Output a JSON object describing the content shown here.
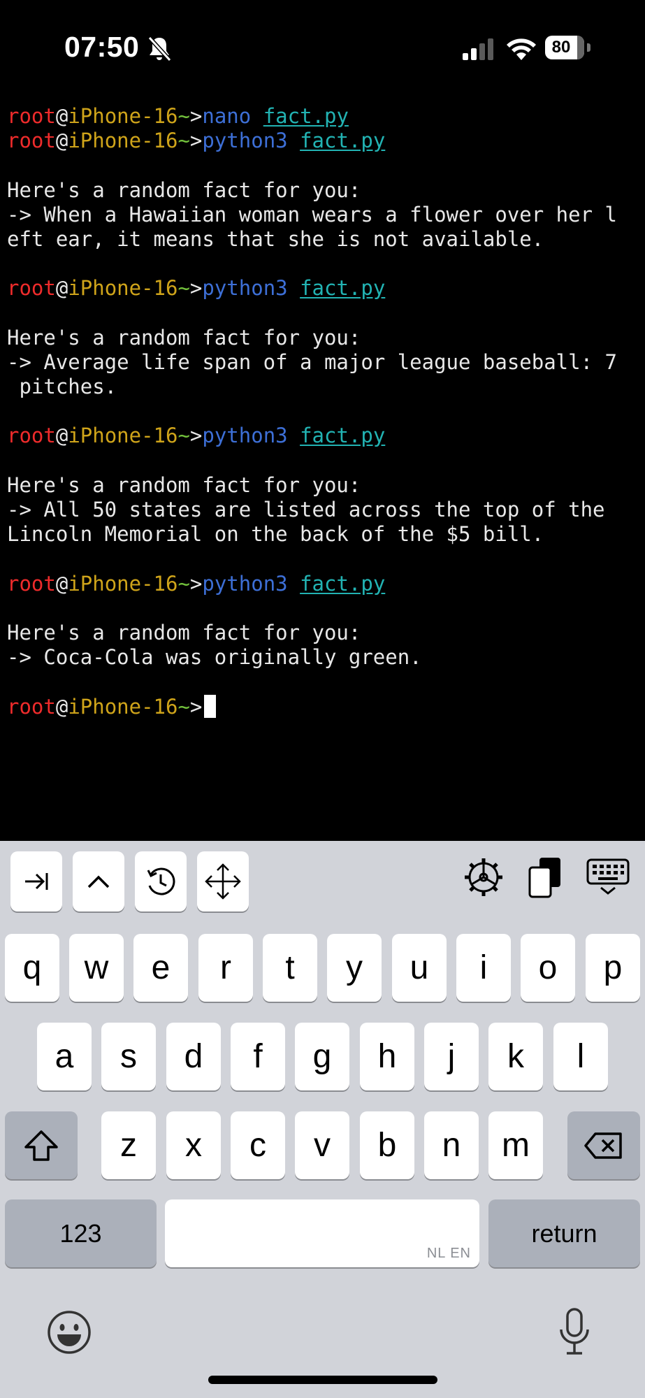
{
  "status_bar": {
    "time": "07:50",
    "battery": "80",
    "icons": [
      "bell-slash-icon",
      "cellular-signal-icon",
      "wifi-icon",
      "battery-icon"
    ]
  },
  "terminal": {
    "prompt": {
      "user": "root",
      "at": "@",
      "host": "iPhone-16",
      "path": "~",
      "gt": ">"
    },
    "lines": [
      {
        "type": "prompt",
        "cmd": "nano",
        "arg": "fact.py"
      },
      {
        "type": "prompt",
        "cmd": "python3",
        "arg": "fact.py"
      },
      {
        "type": "text",
        "text": ""
      },
      {
        "type": "text",
        "text": "Here's a random fact for you:"
      },
      {
        "type": "text",
        "text": "-> When a Hawaiian woman wears a flower over her l"
      },
      {
        "type": "text",
        "text": "eft ear, it means that she is not available."
      },
      {
        "type": "text",
        "text": ""
      },
      {
        "type": "prompt",
        "cmd": "python3",
        "arg": "fact.py"
      },
      {
        "type": "text",
        "text": ""
      },
      {
        "type": "text",
        "text": "Here's a random fact for you:"
      },
      {
        "type": "text",
        "text": "-> Average life span of a major league baseball: 7"
      },
      {
        "type": "text",
        "text": " pitches."
      },
      {
        "type": "text",
        "text": ""
      },
      {
        "type": "prompt",
        "cmd": "python3",
        "arg": "fact.py"
      },
      {
        "type": "text",
        "text": ""
      },
      {
        "type": "text",
        "text": "Here's a random fact for you:"
      },
      {
        "type": "text",
        "text": "-> All 50 states are listed across the top of the"
      },
      {
        "type": "text",
        "text": "Lincoln Memorial on the back of the $5 bill."
      },
      {
        "type": "text",
        "text": ""
      },
      {
        "type": "prompt",
        "cmd": "python3",
        "arg": "fact.py"
      },
      {
        "type": "text",
        "text": ""
      },
      {
        "type": "text",
        "text": "Here's a random fact for you:"
      },
      {
        "type": "text",
        "text": "-> Coca-Cola was originally green."
      },
      {
        "type": "text",
        "text": ""
      },
      {
        "type": "prompt_cursor"
      }
    ]
  },
  "toolbar": {
    "left": [
      "tab-icon",
      "control-caret-icon",
      "history-icon",
      "move-arrows-icon"
    ],
    "right": [
      "settings-gear-icon",
      "clipboard-icon",
      "keyboard-dismiss-icon"
    ]
  },
  "keyboard": {
    "row1": [
      "q",
      "w",
      "e",
      "r",
      "t",
      "y",
      "u",
      "i",
      "o",
      "p"
    ],
    "row2": [
      "a",
      "s",
      "d",
      "f",
      "g",
      "h",
      "j",
      "k",
      "l"
    ],
    "row3": [
      "z",
      "x",
      "c",
      "v",
      "b",
      "n",
      "m"
    ],
    "numbers_label": "123",
    "space_lang": "NL EN",
    "return_label": "return",
    "shift_icon": "shift-icon",
    "delete_icon": "backspace-icon",
    "emoji_icon": "emoji-icon",
    "mic_icon": "microphone-icon"
  }
}
